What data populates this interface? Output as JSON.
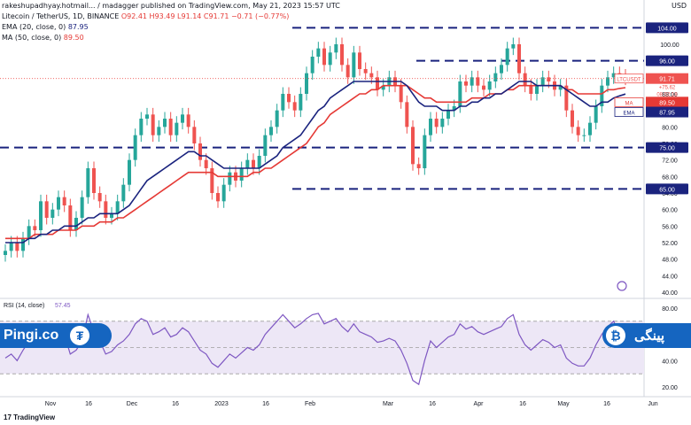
{
  "header": {
    "publisher": "rakeshupadhyay.hotmail... / madagger published on TradingView.com, May 21, 2023 15:57 UTC",
    "pair_line": "Litecoin / TetherUS, 1D, BINANCE",
    "ohlc": "O92.41 H93.49 L91.14 C91.71 −0.71 (−0.77%)",
    "ema": "EMA (20, close, 0)",
    "ema_val": "87.95",
    "ma": "MA (50, close, 0)",
    "ma_val": "89.50",
    "currency": "USD"
  },
  "branding": {
    "left": "Pingi.co",
    "right": "پینگی",
    "tether_icon": "tether-icon",
    "bitcoin_icon": "bitcoin-icon",
    "footer": "TradingView"
  },
  "chart_data": {
    "type": "line",
    "title": "Litecoin / TetherUS, 1D, BINANCE",
    "y_ticks": [
      "104.00",
      "100.00",
      "96.00",
      "92.00",
      "88.00",
      "84.00",
      "80.00",
      "76.00",
      "72.00",
      "68.00",
      "64.00",
      "60.00",
      "56.00",
      "52.00",
      "48.00",
      "44.00",
      "40.00"
    ],
    "ylim": [
      40,
      106
    ],
    "x_ticks": [
      "17",
      "Nov",
      "16",
      "Dec",
      "16",
      "2023",
      "16",
      "Feb",
      "Mar",
      "16",
      "Apr",
      "16",
      "May",
      "16",
      "Jun"
    ],
    "horizontal_levels": [
      {
        "label": "104.00",
        "value": 104
      },
      {
        "label": "96.00",
        "value": 96
      },
      {
        "label": "75.00",
        "value": 75
      },
      {
        "label": "65.00",
        "value": 65
      }
    ],
    "price_tags": [
      {
        "name": "LTCUSDT",
        "text": "91.71",
        "color": "#ef5350"
      },
      {
        "name": "MA",
        "text": "89.50",
        "color": "#e53935"
      },
      {
        "name": "EMA",
        "text": "87.95",
        "color": "#1a237e"
      }
    ],
    "last_price_countdown": "08:02:18",
    "last_price_sub": "+75.62",
    "close": [
      50,
      52,
      50,
      53,
      56,
      55,
      62,
      58,
      60,
      63,
      61,
      55,
      58,
      63,
      70,
      64,
      62,
      58,
      59,
      62,
      66,
      72,
      78,
      82,
      83,
      78,
      80,
      82,
      78,
      81,
      83,
      80,
      76,
      72,
      70,
      64,
      62,
      66,
      69,
      67,
      70,
      72,
      70,
      73,
      78,
      80,
      84,
      88,
      86,
      84,
      88,
      93,
      97,
      99,
      95,
      98,
      100,
      95,
      92,
      98,
      94,
      93,
      92,
      89,
      90,
      92,
      90,
      86,
      80,
      71,
      70,
      78,
      82,
      80,
      82,
      84,
      85,
      91,
      90,
      92,
      90,
      89,
      91,
      93,
      95,
      99,
      100,
      93,
      90,
      88,
      90,
      92,
      91,
      89,
      90,
      84,
      80,
      78,
      78,
      81,
      85,
      90,
      92,
      93,
      92.41,
      91.71
    ],
    "ema20": [
      52,
      52,
      52,
      52,
      53,
      53,
      54,
      54,
      55,
      55,
      56,
      56,
      56,
      57,
      58,
      58,
      59,
      59,
      59,
      59,
      60,
      61,
      63,
      65,
      67,
      68,
      69,
      70,
      71,
      72,
      73,
      74,
      74,
      73,
      73,
      72,
      71,
      70,
      70,
      70,
      70,
      70,
      70,
      70,
      71,
      72,
      73,
      75,
      76,
      77,
      78,
      80,
      82,
      84,
      85,
      87,
      88,
      89,
      90,
      91,
      91,
      91,
      91,
      91,
      91,
      91,
      91,
      91,
      90,
      88,
      86,
      85,
      85,
      85,
      84,
      84,
      84,
      85,
      85,
      86,
      86,
      87,
      87,
      88,
      88,
      89,
      90,
      91,
      91,
      91,
      90,
      90,
      90,
      90,
      90,
      89,
      88,
      87,
      86,
      85,
      85,
      86,
      86,
      87,
      87.5,
      87.95
    ],
    "ma50": [
      53,
      53,
      53,
      53,
      53,
      54,
      54,
      54,
      54,
      55,
      55,
      55,
      55,
      56,
      56,
      56,
      57,
      57,
      57,
      58,
      58,
      59,
      60,
      61,
      62,
      63,
      64,
      65,
      66,
      67,
      68,
      69,
      69,
      69,
      69,
      69,
      68,
      68,
      68,
      68,
      68,
      68,
      69,
      69,
      70,
      70,
      71,
      72,
      73,
      74,
      75,
      76,
      78,
      80,
      81,
      83,
      84,
      85,
      86,
      87,
      88,
      88,
      89,
      89,
      90,
      90,
      90,
      90,
      90,
      89,
      88,
      87,
      87,
      86,
      86,
      86,
      86,
      86,
      86,
      87,
      87,
      87,
      88,
      88,
      88,
      89,
      89,
      90,
      90,
      90,
      90,
      90,
      90,
      90,
      90,
      89,
      89,
      88,
      88,
      88,
      88,
      88,
      89,
      89,
      89.3,
      89.5
    ],
    "rsi_label": "RSI (14, close)",
    "rsi_value": "57.45",
    "rsi_ticks": [
      "80.00",
      "60.00",
      "40.00",
      "20.00"
    ],
    "rsi_ylim": [
      18,
      82
    ],
    "rsi": [
      42,
      45,
      40,
      48,
      55,
      52,
      60,
      58,
      62,
      68,
      60,
      45,
      48,
      55,
      75,
      62,
      55,
      45,
      47,
      52,
      55,
      60,
      68,
      72,
      70,
      60,
      62,
      65,
      58,
      60,
      65,
      62,
      55,
      48,
      45,
      38,
      35,
      40,
      45,
      42,
      46,
      50,
      48,
      52,
      60,
      65,
      70,
      75,
      70,
      65,
      68,
      72,
      75,
      76,
      68,
      70,
      72,
      66,
      62,
      68,
      62,
      60,
      58,
      54,
      55,
      57,
      55,
      48,
      38,
      25,
      22,
      40,
      55,
      50,
      54,
      58,
      60,
      68,
      64,
      66,
      62,
      60,
      62,
      64,
      66,
      72,
      75,
      60,
      52,
      48,
      52,
      56,
      54,
      50,
      52,
      42,
      38,
      36,
      36,
      42,
      52,
      60,
      66,
      70,
      60,
      57.45
    ]
  }
}
